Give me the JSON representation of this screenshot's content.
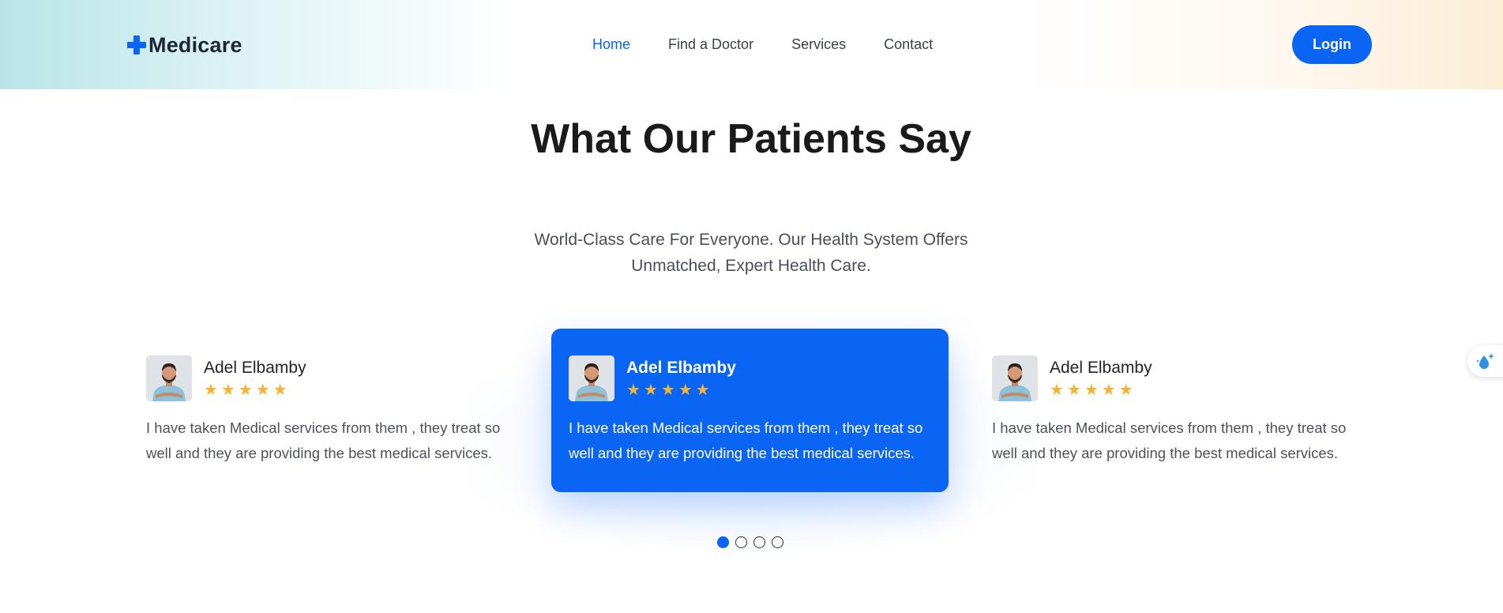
{
  "header": {
    "logo_text": "Medicare",
    "nav": [
      "Home",
      "Find a Doctor",
      "Services",
      "Contact"
    ],
    "active_nav": "Home",
    "login_label": "Login"
  },
  "section": {
    "title": "What Our Patients Say",
    "subtitle": "World-Class Care For Everyone. Our Health System Offers Unmatched, Expert Health Care."
  },
  "testimonials": [
    {
      "name": "Adel Elbamby",
      "rating": 5,
      "quote": "I have taken Medical services from them , they treat so well and they are providing the best medical services."
    },
    {
      "name": "Adel Elbamby",
      "rating": 5,
      "quote": "I have taken Medical services from them , they treat so well and they are providing the best medical services."
    },
    {
      "name": "Adel Elbamby",
      "rating": 5,
      "quote": "I have taken Medical services from them , they treat so well and they are providing the best medical services."
    }
  ],
  "carousel": {
    "pages": 4,
    "active_page": 1
  },
  "icons": {
    "logo": "plus-cross-icon",
    "star": "star-icon",
    "floating": "water-drop-sparkle-icon"
  },
  "colors": {
    "primary": "#0a64f4",
    "star": "#f7b32b",
    "text_dark": "#1a1a1a",
    "text_muted": "#4d5259"
  }
}
